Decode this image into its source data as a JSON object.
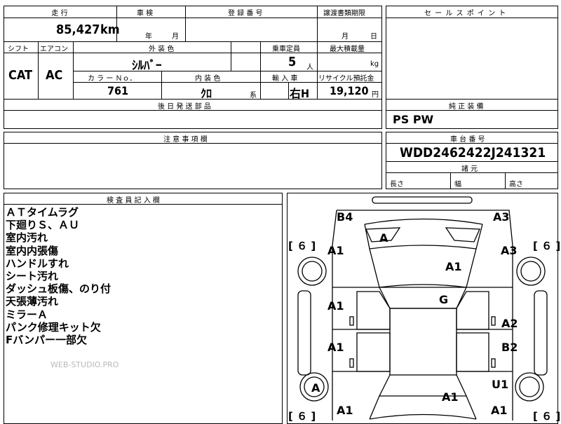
{
  "top": {
    "mileage_label": "走 行",
    "mileage_value": "85,427",
    "mileage_unit": "km",
    "inspection_label": "車 検",
    "inspection_year": "年",
    "inspection_month": "月",
    "registration_label": "登 録 番 号",
    "transfer_label": "譲渡書類期限",
    "transfer_month": "月",
    "transfer_day": "日",
    "shift_label": "シフト",
    "shift_value": "CAT",
    "aircon_label": "エアコン",
    "aircon_value": "AC",
    "exterior_label": "外 装 色",
    "exterior_value": "ｼﾙﾊﾞｰ",
    "capacity_label": "乗車定員",
    "capacity_value": "5",
    "capacity_unit": "人",
    "load_label": "最大積載量",
    "load_unit": "kg",
    "color_no_label": "カ ラ ー Ｎｏ．",
    "color_no_value": "761",
    "interior_label": "内 装 色",
    "interior_value": "ｸﾛ",
    "interior_unit": "系",
    "import_label": "輸 入 車",
    "import_value": "右H",
    "recycle_label": "リサイクル預託金",
    "recycle_value": "19,120",
    "recycle_unit": "円",
    "later_parts_label": "後 日 発 送 部 品"
  },
  "sales_points_label": "セ ー ル ス ポ イ ン ト",
  "equipment_label": "純 正 装 備",
  "equipment_value": "PS PW",
  "caution_label": "注 意 事 項 欄",
  "chassis_label": "車 台 番 号",
  "chassis_value": "WDD2462422J241321",
  "dims": {
    "label": "諸 元",
    "length": "長さ",
    "width": "幅",
    "height": "高さ"
  },
  "inspector": {
    "label": "検 査 員 記 入 欄",
    "notes": [
      "ＡＴタイムラグ",
      "下廻りＳ、ＡＵ",
      "室内汚れ",
      "室内内張傷",
      "ハンドルすれ",
      "シート汚れ",
      "ダッシュ板傷、のり付",
      "天張薄汚れ",
      "ミラーＡ",
      "パンク修理キット欠",
      "Fバンパー一部欠"
    ]
  },
  "watermark": "WEB-STUDIO.PRO",
  "diagram": {
    "marks": {
      "b4": "B4",
      "a3_top": "A3",
      "a_hood": "A",
      "a1_fl": "A1",
      "a1_hood": "A1",
      "a3_fr": "A3",
      "a1_fd": "A1",
      "g": "G",
      "a2_rd": "A2",
      "a1_rdl": "A1",
      "b2": "B2",
      "a_rl": "A",
      "u1": "U1",
      "a1_trunk": "A1",
      "a1_rl": "A1",
      "a1_rr": "A1"
    },
    "tire_fl": "６",
    "tire_fr": "６",
    "tire_rl": "６",
    "tire_rr": "６"
  }
}
